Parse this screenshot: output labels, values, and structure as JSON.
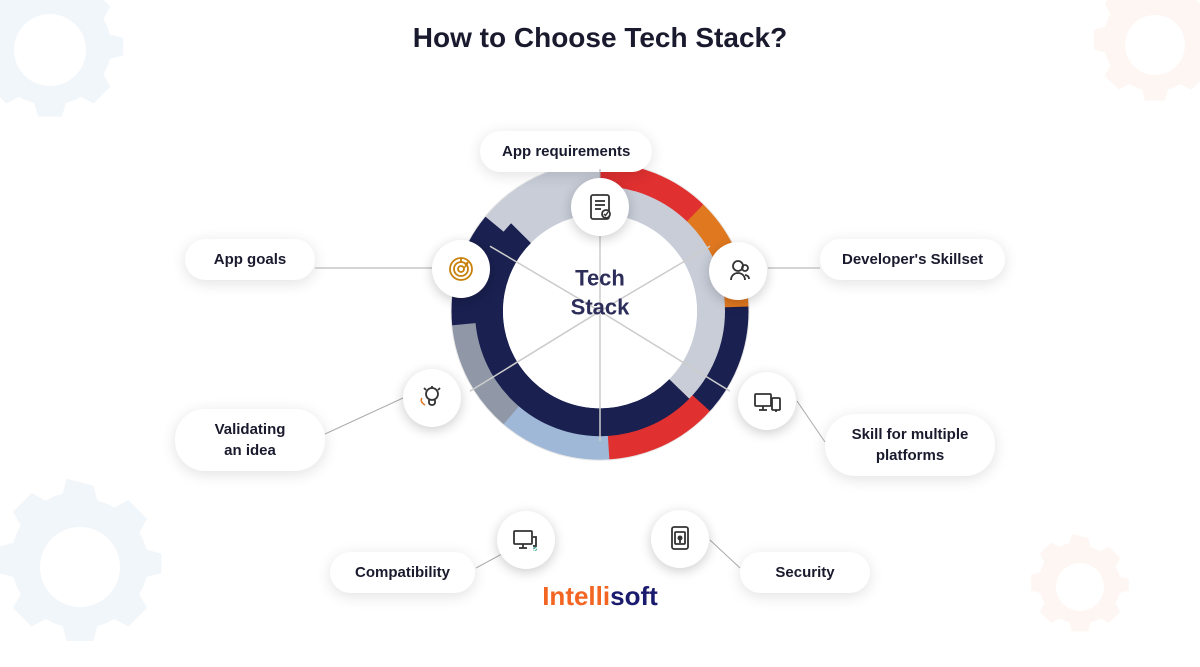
{
  "title": "How to Choose Tech Stack?",
  "labels": {
    "app_requirements": "App requirements",
    "developers_skillset": "Developer's Skillset",
    "skill_multiple_platforms": "Skill for multiple\nplatforms",
    "security": "Security",
    "compatibility": "Compatibility",
    "validating_idea": "Validating\nan idea",
    "app_goals": "App goals",
    "tech_stack": "Tech\nStack"
  },
  "brand": {
    "part1": "Intelli",
    "part2": "soft"
  },
  "colors": {
    "red": "#e63030",
    "orange": "#e07820",
    "gold": "#c8a020",
    "dark_navy": "#1a1a4e",
    "mid_navy": "#2a2a6e",
    "gray": "#b0b8c8",
    "light_blue": "#a8c4e8",
    "brand_orange": "#f26522",
    "brand_navy": "#1a1a6e"
  }
}
